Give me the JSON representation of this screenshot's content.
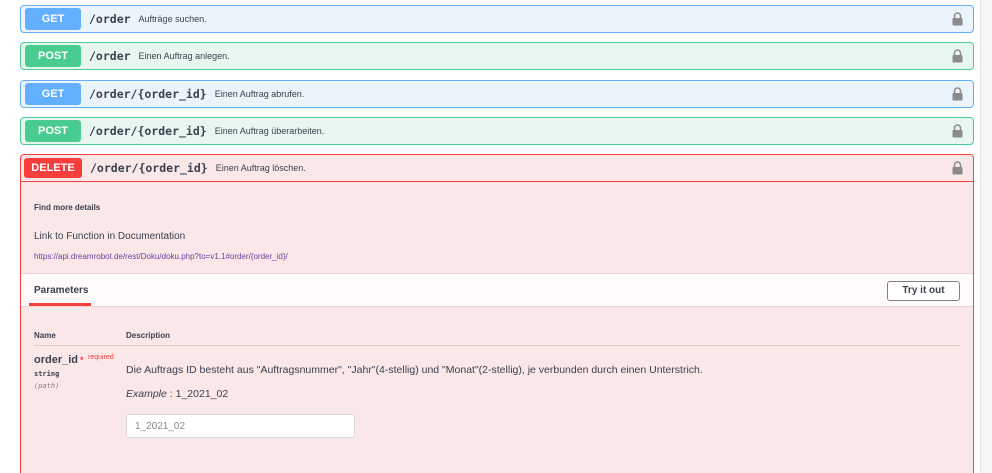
{
  "endpoints": [
    {
      "method": "GET",
      "path": "/order",
      "description": "Aufträge suchen."
    },
    {
      "method": "POST",
      "path": "/order",
      "description": "Einen Auftrag anlegen."
    },
    {
      "method": "GET",
      "path": "/order/{order_id}",
      "description": "Einen Auftrag abrufen."
    },
    {
      "method": "POST",
      "path": "/order/{order_id}",
      "description": "Einen Auftrag überarbeiten."
    },
    {
      "method": "DELETE",
      "path": "/order/{order_id}",
      "description": "Einen Auftrag löschen."
    }
  ],
  "details": {
    "find_more": "Find more details",
    "doc_title": "Link to Function in Documentation",
    "doc_url": "https://api.dreamrobot.de/rest/Doku/doku.php?to=v1.1#order/{order_id}/"
  },
  "parameters": {
    "tab_label": "Parameters",
    "try_button": "Try it out",
    "col_name": "Name",
    "col_description": "Description",
    "items": [
      {
        "name": "order_id",
        "required_star": "*",
        "required_label": "required",
        "type": "string",
        "in": "(path)",
        "description": "Die Auftrags ID besteht aus \"Auftragsnummer\", \"Jahr\"(4-stellig) und \"Monat\"(2-stellig), je verbunden durch einen Unterstrich.",
        "example_label": "Example",
        "example_sep": " : ",
        "example_value": "1_2021_02",
        "placeholder": "1_2021_02"
      }
    ]
  },
  "colors": {
    "get": "#61affe",
    "post": "#49cc90",
    "delete": "#f93e3e"
  },
  "icons": {
    "lock": "lock-icon"
  }
}
